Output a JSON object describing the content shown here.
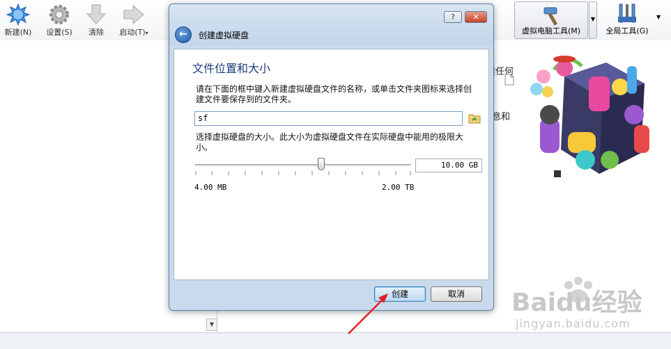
{
  "toolbar": {
    "new_label": "新建(N)",
    "settings_label": "设置(S)",
    "discard_label": "清除",
    "start_label": "启动(T)",
    "machine_tools_label": "虚拟电脑工具(M)",
    "global_tools_label": "全局工具(G)"
  },
  "right_pane": {
    "text_fragment_1": "建任何",
    "text_fragment_2": "息和"
  },
  "dialog": {
    "title": "创建虚拟硬盘",
    "help_label": "?",
    "close_label": "✕",
    "page_title": "文件位置和大小",
    "location_description": "请在下面的框中键入新建虚拟硬盘文件的名称，或单击文件夹图标来选择创建文件要保存到的文件夹。",
    "location_value": "sf",
    "size_description": "选择虚拟硬盘的大小。此大小为虚拟硬盘文件在实际硬盘中能用的极限大小。",
    "size_value": "10.00 GB",
    "min_size": "4.00 MB",
    "max_size": "2.00 TB",
    "slider_fraction": 0.585,
    "create_label": "创建",
    "cancel_label": "取消"
  },
  "watermark": {
    "text": "Baidu经验",
    "url": "jingyan.baidu.com"
  },
  "colors": {
    "title_blue": "#1a3d7a",
    "close_red": "#c7412a",
    "arrow_red": "#e02020"
  }
}
